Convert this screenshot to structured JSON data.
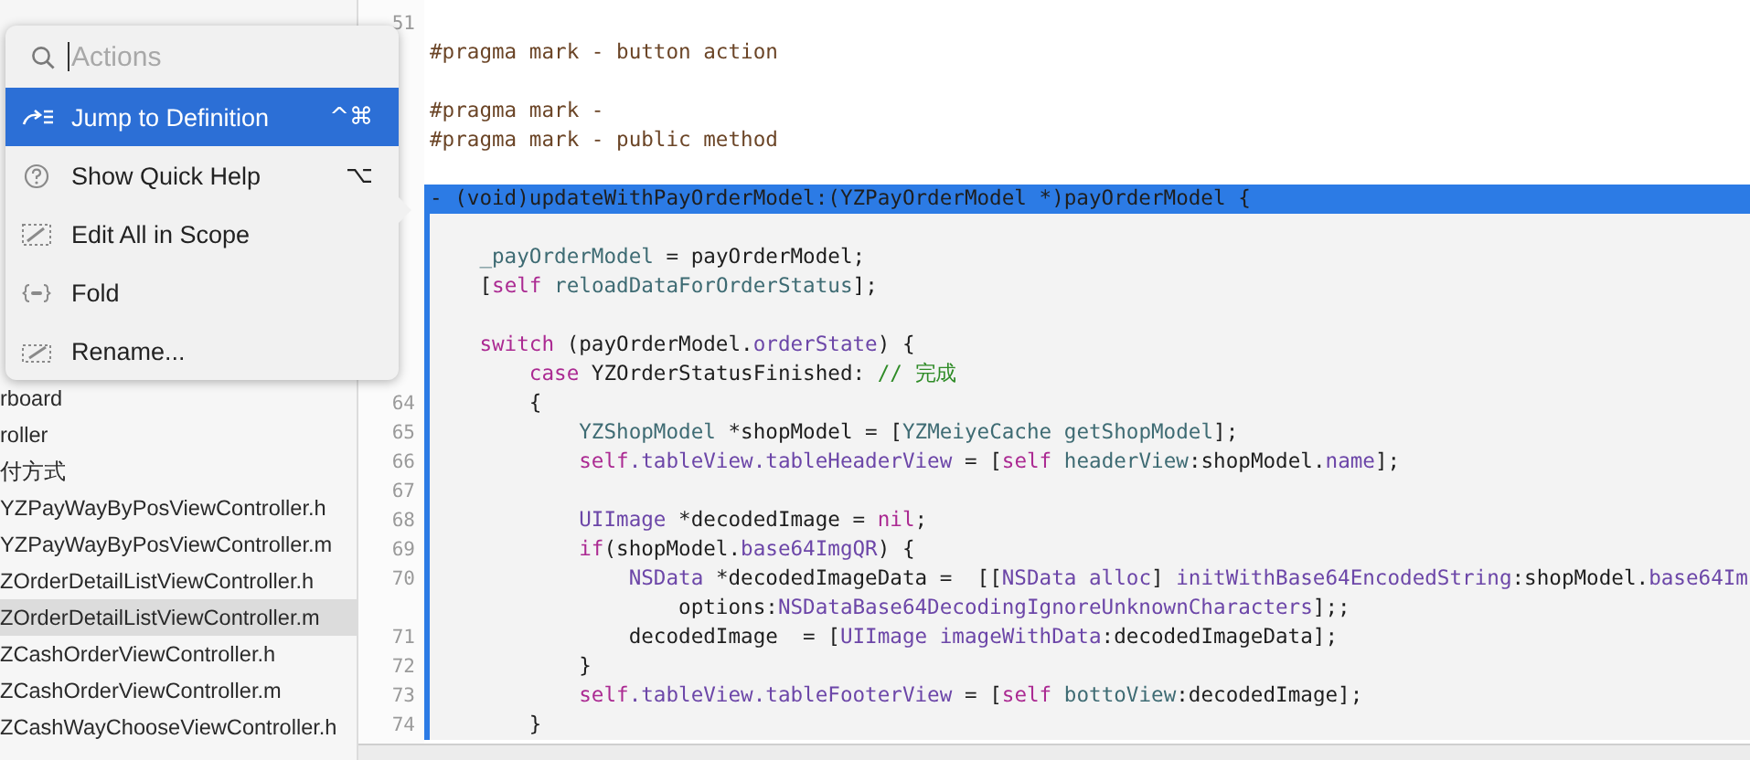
{
  "navigator": {
    "items": [
      {
        "label": "rboard",
        "selected": false
      },
      {
        "label": "roller",
        "selected": false
      },
      {
        "label": "付方式",
        "selected": false
      },
      {
        "label": "YZPayWayByPosViewController.h",
        "selected": false
      },
      {
        "label": "YZPayWayByPosViewController.m",
        "selected": false
      },
      {
        "label": "ZOrderDetailListViewController.h",
        "selected": false
      },
      {
        "label": "ZOrderDetailListViewController.m",
        "selected": true
      },
      {
        "label": "ZCashOrderViewController.h",
        "selected": false
      },
      {
        "label": "ZCashOrderViewController.m",
        "selected": false
      },
      {
        "label": "ZCashWayChooseViewController.h",
        "selected": false
      }
    ]
  },
  "actions_popup": {
    "search": {
      "placeholder": "Actions"
    },
    "items": [
      {
        "label": "Jump to Definition",
        "shortcut": "^⌘",
        "selected": true
      },
      {
        "label": "Show Quick Help",
        "shortcut": "⌥",
        "selected": false
      },
      {
        "label": "Edit All in Scope",
        "selected": false
      },
      {
        "label": "Fold",
        "selected": false
      },
      {
        "label": "Rename...",
        "selected": false
      }
    ]
  },
  "editor": {
    "lines": [
      {
        "kind": "blank",
        "number": "51"
      },
      {
        "kind": "code",
        "tokens": [
          {
            "text": "#pragma mark - button action",
            "kind": "pragma"
          }
        ]
      },
      {
        "kind": "blank"
      },
      {
        "kind": "code",
        "tokens": [
          {
            "text": "#pragma mark -",
            "kind": "pragma"
          }
        ]
      },
      {
        "kind": "code",
        "tokens": [
          {
            "text": "#pragma mark - public method",
            "kind": "pragma"
          }
        ]
      },
      {
        "kind": "blank"
      }
    ],
    "highlighted_scope": {
      "header": {
        "text": "- (void)updateWithPayOrderModel:(YZPayOrderModel *)payOrderModel {"
      },
      "lines": [
        {
          "kind": "blank"
        },
        {
          "tokens": [
            {
              "text": "    _payOrderModel",
              "kind": "member"
            },
            {
              "text": " = payOrderModel;",
              "kind": "plain"
            }
          ]
        },
        {
          "tokens": [
            {
              "text": "    [",
              "kind": "plain"
            },
            {
              "text": "self",
              "kind": "keyword"
            },
            {
              "text": " reloadDataForOrderStatus",
              "kind": "member"
            },
            {
              "text": "];",
              "kind": "plain"
            }
          ]
        },
        {
          "kind": "blank"
        },
        {
          "tokens": [
            {
              "text": "    switch",
              "kind": "keyword"
            },
            {
              "text": " (payOrderModel.",
              "kind": "plain"
            },
            {
              "text": "orderState",
              "kind": "system"
            },
            {
              "text": ") {",
              "kind": "plain"
            }
          ]
        },
        {
          "tokens": [
            {
              "text": "        case",
              "kind": "keyword"
            },
            {
              "text": " YZOrderStatusFinished: ",
              "kind": "plain"
            },
            {
              "text": "// 完成",
              "kind": "comment"
            }
          ]
        },
        {
          "number": "64",
          "tokens": [
            {
              "text": "        {",
              "kind": "plain"
            }
          ]
        },
        {
          "number": "65",
          "tokens": [
            {
              "text": "            YZShopModel",
              "kind": "member"
            },
            {
              "text": " *shopModel = [",
              "kind": "plain"
            },
            {
              "text": "YZMeiyeCache",
              "kind": "member"
            },
            {
              "text": " getShopModel",
              "kind": "member"
            },
            {
              "text": "];",
              "kind": "plain"
            }
          ]
        },
        {
          "number": "66",
          "tokens": [
            {
              "text": "            self",
              "kind": "keyword"
            },
            {
              "text": ".tableView",
              "kind": "system"
            },
            {
              "text": ".tableHeaderView",
              "kind": "system"
            },
            {
              "text": " = [",
              "kind": "plain"
            },
            {
              "text": "self",
              "kind": "keyword"
            },
            {
              "text": " headerView",
              "kind": "member"
            },
            {
              "text": ":shopModel.",
              "kind": "plain"
            },
            {
              "text": "name",
              "kind": "system"
            },
            {
              "text": "];",
              "kind": "plain"
            }
          ]
        },
        {
          "kind": "blank",
          "number": "67"
        },
        {
          "number": "68",
          "tokens": [
            {
              "text": "            UIImage",
              "kind": "system"
            },
            {
              "text": " *decodedImage = ",
              "kind": "plain"
            },
            {
              "text": "nil",
              "kind": "keyword"
            },
            {
              "text": ";",
              "kind": "plain"
            }
          ]
        },
        {
          "number": "69",
          "tokens": [
            {
              "text": "            if",
              "kind": "keyword"
            },
            {
              "text": "(shopModel.",
              "kind": "plain"
            },
            {
              "text": "base64ImgQR",
              "kind": "system"
            },
            {
              "text": ") {",
              "kind": "plain"
            }
          ]
        },
        {
          "number": "70",
          "tokens": [
            {
              "text": "                NSData",
              "kind": "system"
            },
            {
              "text": " *decodedImageData =  [[",
              "kind": "plain"
            },
            {
              "text": "NSData alloc",
              "kind": "system"
            },
            {
              "text": "] ",
              "kind": "plain"
            },
            {
              "text": "initWithBase64EncodedString",
              "kind": "system"
            },
            {
              "text": ":shopModel.",
              "kind": "plain"
            },
            {
              "text": "base64Im",
              "kind": "system"
            }
          ]
        },
        {
          "tokens": [
            {
              "text": "                    options:",
              "kind": "plain"
            },
            {
              "text": "NSDataBase64DecodingIgnoreUnknownCharacters",
              "kind": "system"
            },
            {
              "text": "];;",
              "kind": "plain"
            }
          ]
        },
        {
          "number": "71",
          "tokens": [
            {
              "text": "                decodedImage  = [",
              "kind": "plain"
            },
            {
              "text": "UIImage imageWithData",
              "kind": "system"
            },
            {
              "text": ":decodedImageData];",
              "kind": "plain"
            }
          ]
        },
        {
          "number": "72",
          "tokens": [
            {
              "text": "            }",
              "kind": "plain"
            }
          ]
        },
        {
          "number": "73",
          "tokens": [
            {
              "text": "            self",
              "kind": "keyword"
            },
            {
              "text": ".tableView.tableFooterView",
              "kind": "system"
            },
            {
              "text": " = [",
              "kind": "plain"
            },
            {
              "text": "self",
              "kind": "keyword"
            },
            {
              "text": " bottoView",
              "kind": "member"
            },
            {
              "text": ":decodedImage];",
              "kind": "plain"
            }
          ]
        },
        {
          "number": "74",
          "tokens": [
            {
              "text": "        }",
              "kind": "plain"
            }
          ]
        }
      ]
    }
  }
}
